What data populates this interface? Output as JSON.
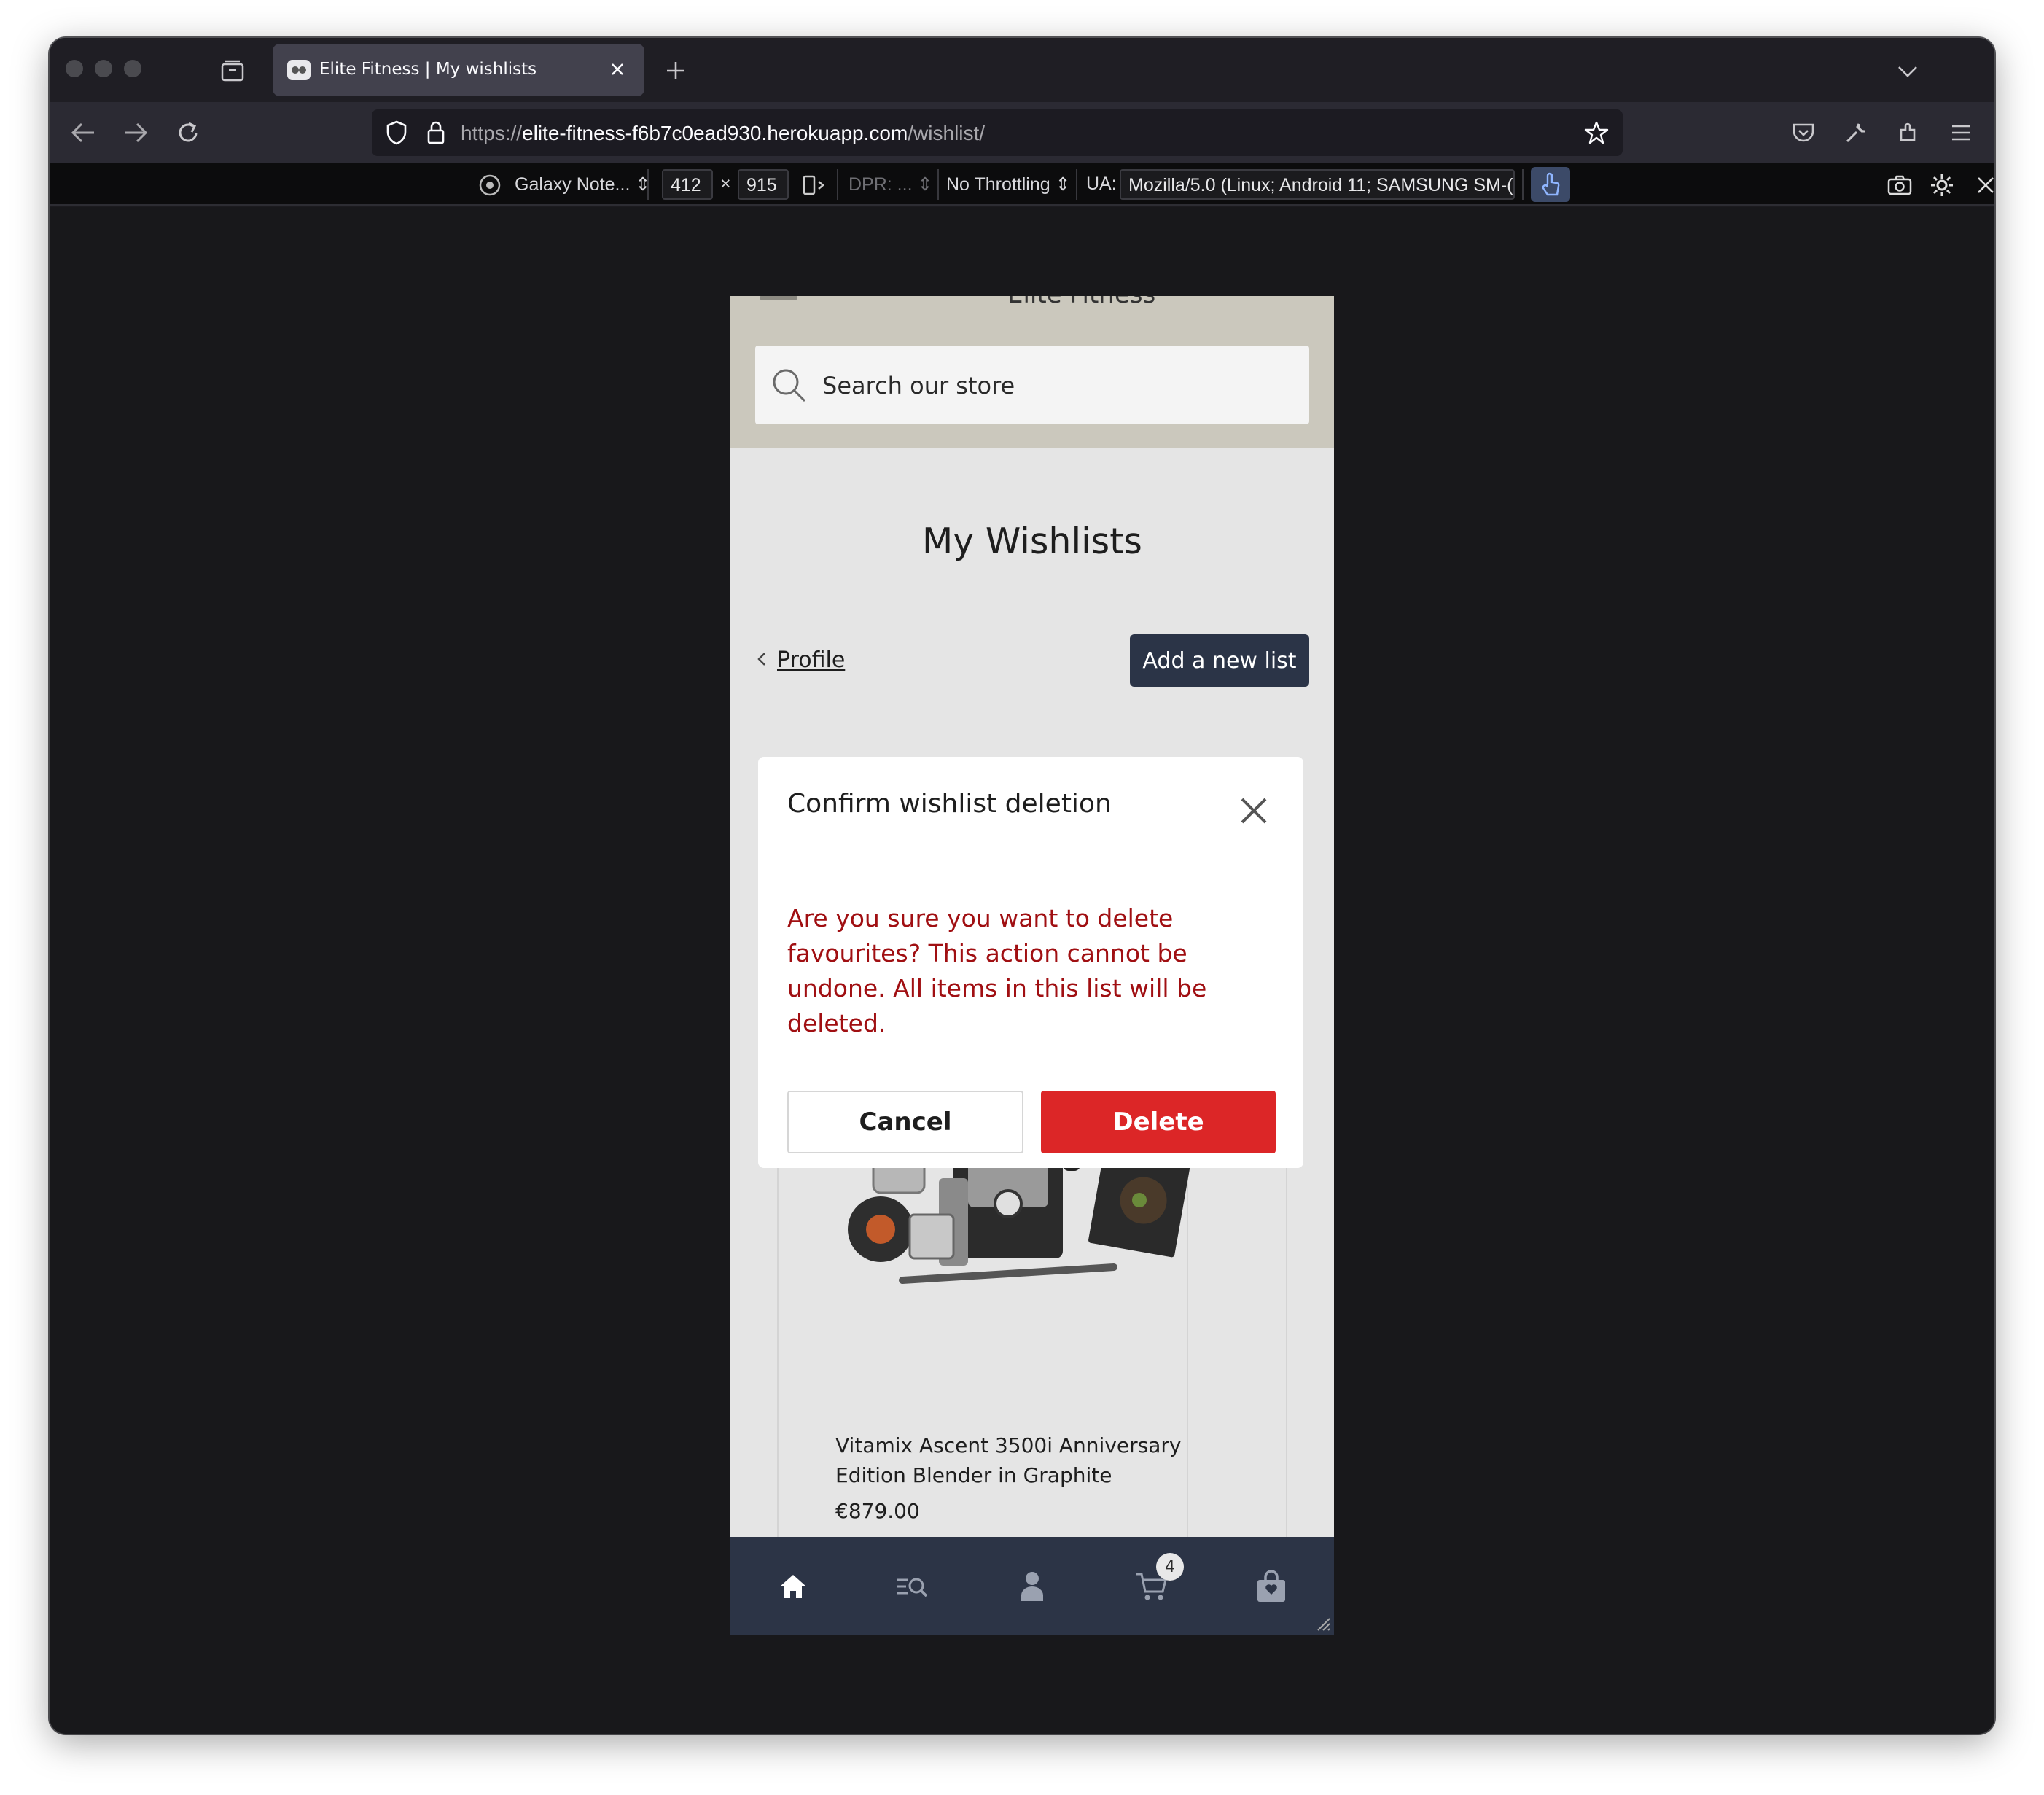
{
  "browser": {
    "tab_title": "Elite Fitness | My wishlists",
    "url_prefix": "https://",
    "url_host": "elite-fitness-f6b7c0ead930.herokuapp.com",
    "url_path": "/wishlist/"
  },
  "rdm": {
    "device": "Galaxy Note...",
    "width": "412",
    "times": "×",
    "height": "915",
    "dpr": "DPR: ...",
    "throttling": "No Throttling",
    "ua_label": "UA:",
    "ua_value": "Mozilla/5.0 (Linux; Android 11; SAMSUNG SM-("
  },
  "site": {
    "header_title": "Elite Fitness",
    "search_placeholder": "Search our store",
    "page_title": "My Wishlists",
    "profile_link": "Profile",
    "add_list_button": "Add a new list"
  },
  "modal": {
    "title": "Confirm wishlist deletion",
    "message": "Are you sure you want to delete favourites? This action cannot be undone. All items in this list will be deleted.",
    "cancel_label": "Cancel",
    "delete_label": "Delete"
  },
  "product": {
    "name": "Vitamix Ascent 3500i Anniversary Edition Blender in Graphite",
    "price": "€879.00"
  },
  "bottom_nav": {
    "items": [
      "home-icon",
      "search-list-icon",
      "user-icon",
      "cart-icon",
      "bag-icon"
    ],
    "cart_count": "4"
  },
  "colors": {
    "header_bg": "#cbc8bd",
    "primary_button": "#2b3447",
    "delete_button": "#dc2627",
    "warning_text": "#a00f12",
    "bottom_nav_bg": "#2c3446"
  }
}
